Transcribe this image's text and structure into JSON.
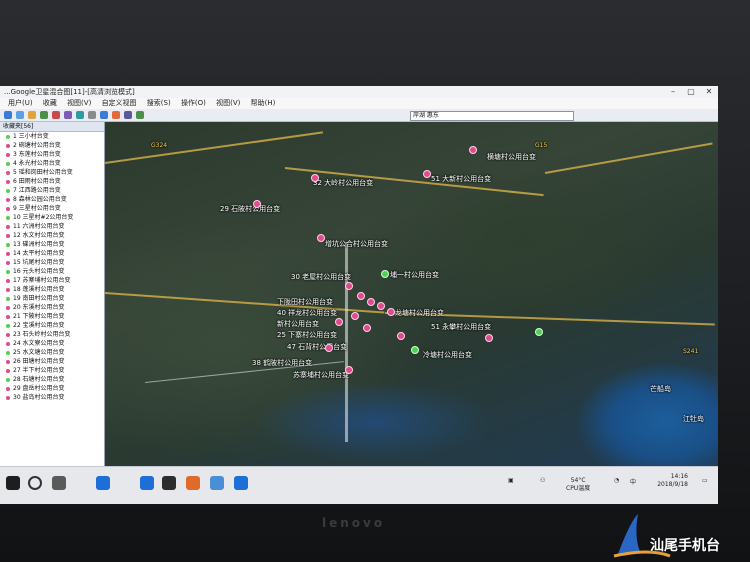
{
  "window": {
    "title": "...Google卫星混合图[11]-[高清浏览模式]"
  },
  "menu": [
    "用户(U)",
    "收藏",
    "视图(V)",
    "自定义视图",
    "搜索(S)",
    "操作(O)",
    "视图(V)",
    "帮助(H)"
  ],
  "toolbar": {
    "address_text": "岸湖  惠东"
  },
  "sidebar": {
    "header": "收藏夹[56]",
    "items": [
      "1 三小村台变",
      "2 碗塘村公用台变",
      "3 东莲村公用台变",
      "4 永光村公用台变",
      "5 瑶和岗田村公用台变",
      "6 田雨村公用台变",
      "7 江西路公用台变",
      "8 森林公园公用台变",
      "9 三星村公用台变",
      "10 三星村#2公用台变",
      "11 六洲村公用台变",
      "12 水文村公用台变",
      "13 碟洲村公用台变",
      "14 太平村公用台变",
      "15 坑尾村公用台变",
      "16 元头村公用台变",
      "17 苏寨埔村公用台变",
      "18 蓬溪村公用台变",
      "19 南田村公用台变",
      "20 东溪村公用台变",
      "21 下陂村公用台变",
      "22 宝溪村公用台变",
      "23 石头岭村公用台变",
      "24 水文寮公用台变",
      "25 水文塘公用台变",
      "26 田塘村公用台变",
      "27 半下村公用台变",
      "28 石塘村公用台变",
      "29 盘岳村公用台变",
      "30 盐岛村公用台变"
    ]
  },
  "map": {
    "labels": [
      {
        "text": "横塘村公用台变"
      },
      {
        "text": "51 大新村公用台变"
      },
      {
        "text": "32 大岭村公用台变"
      },
      {
        "text": "29 石陂村公用台变"
      },
      {
        "text": "增坑公合村公用台变"
      },
      {
        "text": "30 老屋村公用台变"
      },
      {
        "text": "埔一村公用台变"
      },
      {
        "text": "下陇田村公用台变"
      },
      {
        "text": "40 祥龙村公用台变"
      },
      {
        "text": "新村公用台变"
      },
      {
        "text": "龙塘村公用台变"
      },
      {
        "text": "25 下寨村公用台变"
      },
      {
        "text": "47 石背村公用台变"
      },
      {
        "text": "38 鹤陂村公用台变"
      },
      {
        "text": "苏寨埔村公用台变"
      },
      {
        "text": "51 永攀村公用台变"
      },
      {
        "text": "冷塘村公用台变"
      },
      {
        "text": "芒船岛"
      },
      {
        "text": "江牡岛"
      },
      {
        "text": "G324"
      },
      {
        "text": "G15"
      },
      {
        "text": "S241"
      }
    ]
  },
  "taskbar": {
    "temp": "54°C",
    "temp_label": "CPU温度",
    "ime": "中",
    "time": "14:16",
    "date": "2018/9/18"
  },
  "laptop": {
    "brand": "lenovo"
  },
  "watermark": {
    "text": "汕尾手机台"
  },
  "colors": {
    "pin_pink": "#e04a8e",
    "pin_green": "#4fd24f",
    "road_yellow": "#d7b04b"
  }
}
